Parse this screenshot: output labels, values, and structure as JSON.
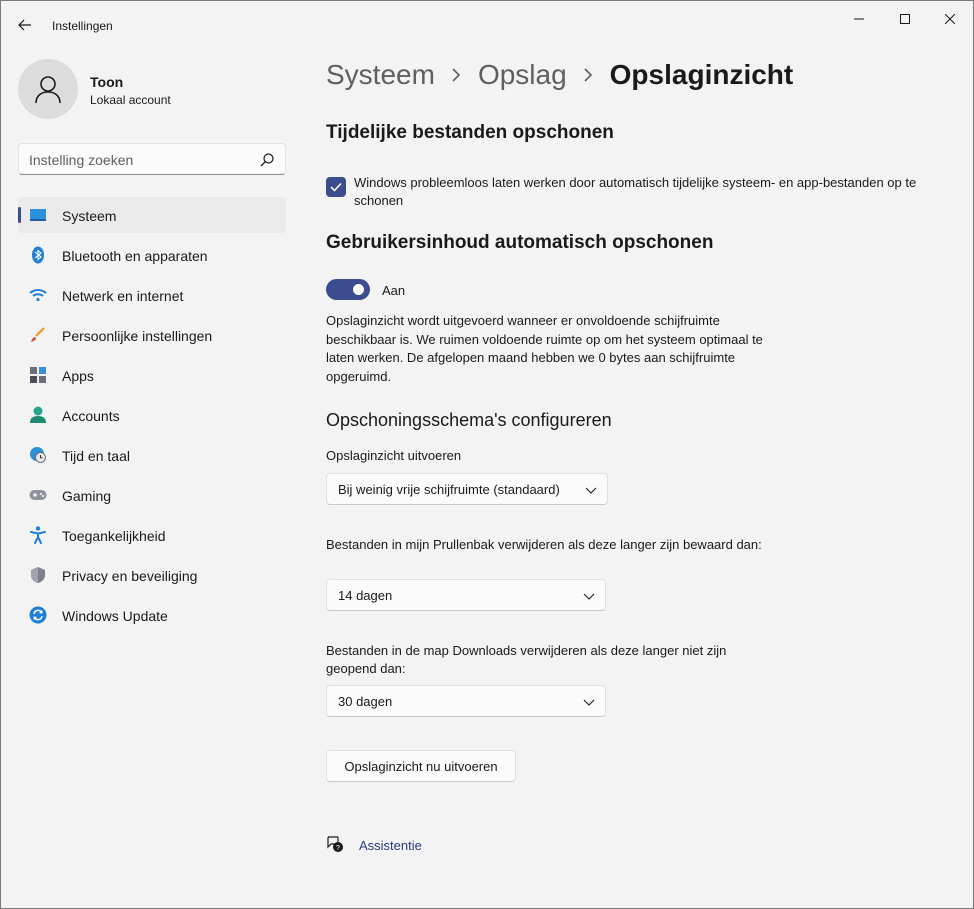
{
  "window": {
    "title": "Instellingen",
    "accent": "#3b4c8f"
  },
  "profile": {
    "name": "Toon",
    "account_type": "Lokaal account"
  },
  "search": {
    "placeholder": "Instelling zoeken"
  },
  "sidebar": {
    "items": [
      {
        "label": "Systeem",
        "icon": "system-icon",
        "active": true
      },
      {
        "label": "Bluetooth en apparaten",
        "icon": "bluetooth-icon"
      },
      {
        "label": "Netwerk en internet",
        "icon": "wifi-icon"
      },
      {
        "label": "Persoonlijke instellingen",
        "icon": "brush-icon"
      },
      {
        "label": "Apps",
        "icon": "apps-icon"
      },
      {
        "label": "Accounts",
        "icon": "accounts-icon"
      },
      {
        "label": "Tijd en taal",
        "icon": "clock-globe-icon"
      },
      {
        "label": "Gaming",
        "icon": "gamepad-icon"
      },
      {
        "label": "Toegankelijkheid",
        "icon": "accessibility-icon"
      },
      {
        "label": "Privacy en beveiliging",
        "icon": "shield-icon"
      },
      {
        "label": "Windows Update",
        "icon": "update-icon"
      }
    ]
  },
  "breadcrumb": {
    "part1": "Systeem",
    "part2": "Opslag",
    "current": "Opslaginzicht",
    "separator": "›"
  },
  "temp_files": {
    "heading": "Tijdelijke bestanden opschonen",
    "checkbox_label": "Windows probleemloos laten werken door automatisch tijdelijke systeem- en app-bestanden op te schonen",
    "checked": true
  },
  "auto_cleanup": {
    "heading": "Gebruikersinhoud automatisch opschonen",
    "toggle_label": "Aan",
    "toggle_on": true,
    "description": "Opslaginzicht wordt uitgevoerd wanneer er onvoldoende schijfruimte beschikbaar is. We ruimen voldoende ruimte op om het systeem optimaal te laten werken. De afgelopen maand hebben we 0 bytes aan schijfruimte opgeruimd."
  },
  "schedule": {
    "heading": "Opschoningsschema's configureren",
    "run_label": "Opslaginzicht uitvoeren",
    "run_value": "Bij weinig vrije schijfruimte (standaard)",
    "recycle_label": "Bestanden in mijn Prullenbak verwijderen als deze langer zijn bewaard dan:",
    "recycle_value": "14 dagen",
    "downloads_label": "Bestanden in de map Downloads verwijderen als deze langer niet zijn geopend dan:",
    "downloads_value": "30 dagen",
    "run_now_button": "Opslaginzicht nu uitvoeren"
  },
  "help": {
    "link": "Assistentie"
  }
}
